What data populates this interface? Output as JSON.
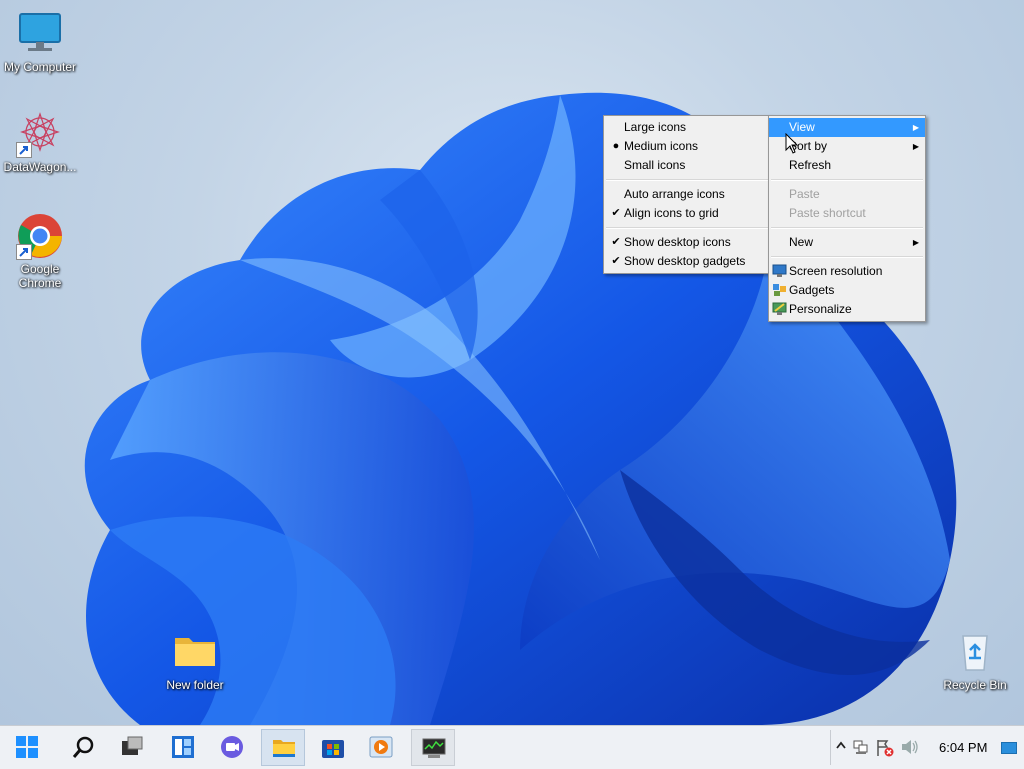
{
  "desktop_icons": [
    {
      "label": "My Computer",
      "icon": "monitor-icon"
    },
    {
      "label": "DataWagon...",
      "icon": "datawagon-logo-icon"
    },
    {
      "label": "Google Chrome",
      "icon": "chrome-icon"
    },
    {
      "label": "New folder",
      "icon": "folder-icon"
    },
    {
      "label": "Recycle Bin",
      "icon": "recycle-bin-icon"
    }
  ],
  "main_menu": {
    "view": "View",
    "sort_by": "Sort by",
    "refresh": "Refresh",
    "paste": "Paste",
    "paste_shortcut": "Paste shortcut",
    "new": "New",
    "screen_resolution": "Screen resolution",
    "gadgets": "Gadgets",
    "personalize": "Personalize"
  },
  "view_submenu": {
    "large_icons": "Large icons",
    "medium_icons": "Medium icons",
    "small_icons": "Small icons",
    "auto_arrange": "Auto arrange icons",
    "align_to_grid": "Align icons to grid",
    "show_desktop_icons": "Show desktop icons",
    "show_desktop_gadgets": "Show desktop gadgets",
    "selected_size": "Medium icons",
    "checked": [
      "Align icons to grid",
      "Show desktop icons",
      "Show desktop gadgets"
    ]
  },
  "taskbar": {
    "buttons": [
      "start-icon",
      "search-icon",
      "task-view-icon",
      "widgets-icon",
      "chat-icon",
      "file-explorer-icon",
      "store-icon",
      "media-player-icon",
      "system-monitor-icon"
    ],
    "clock": "6:04 PM"
  },
  "colors": {
    "menu_highlight": "#3399ff",
    "wallpaper_blue": "#1a5fe0",
    "taskbar_bg": "#eef1f5"
  }
}
